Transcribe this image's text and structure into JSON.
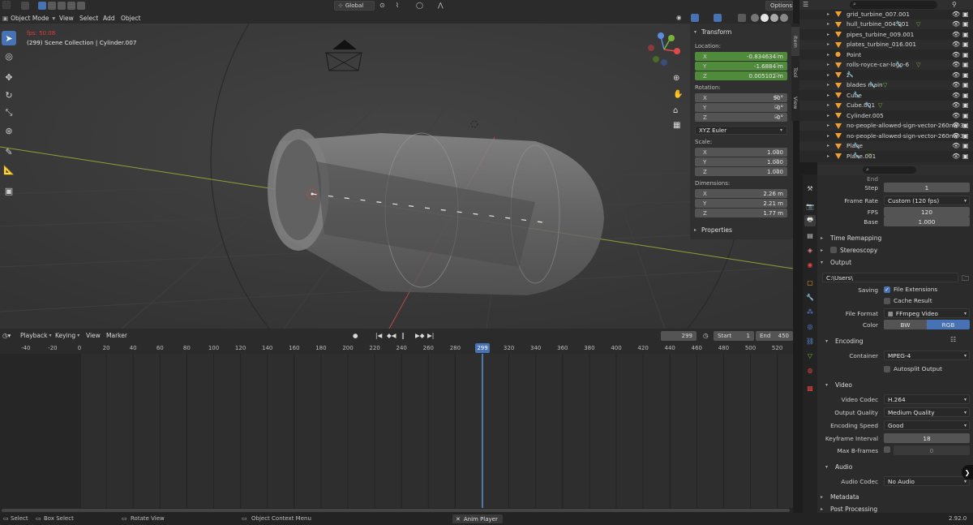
{
  "header": {
    "mode": "Object Mode",
    "menus": [
      "View",
      "Select",
      "Add",
      "Object"
    ],
    "orientation": "Global",
    "options_label": "Options"
  },
  "viewport": {
    "fps_text": "fps: 50.08",
    "collection_text": "(299) Scene Collection | Cylinder.007"
  },
  "npanel": {
    "tabs": [
      "Item",
      "Tool",
      "View"
    ],
    "transform_title": "Transform",
    "location_label": "Location:",
    "location": [
      {
        "axis": "X",
        "value": "-0.834634 m"
      },
      {
        "axis": "Y",
        "value": "-1.6884 m"
      },
      {
        "axis": "Z",
        "value": "0.005102 m"
      }
    ],
    "rotation_label": "Rotation:",
    "rotation": [
      {
        "axis": "X",
        "value": "90°"
      },
      {
        "axis": "Y",
        "value": "-0°"
      },
      {
        "axis": "Z",
        "value": "-0°"
      }
    ],
    "rotation_mode": "XYZ Euler",
    "scale_label": "Scale:",
    "scale": [
      {
        "axis": "X",
        "value": "1.000"
      },
      {
        "axis": "Y",
        "value": "1.000"
      },
      {
        "axis": "Z",
        "value": "1.000"
      }
    ],
    "dimensions_label": "Dimensions:",
    "dimensions": [
      {
        "axis": "X",
        "value": "2.26 m"
      },
      {
        "axis": "Y",
        "value": "2.21 m"
      },
      {
        "axis": "Z",
        "value": "1.77 m"
      }
    ],
    "properties_title": "Properties"
  },
  "timeline": {
    "menus": [
      "Playback",
      "Keying",
      "View",
      "Marker"
    ],
    "current_frame": "299",
    "start_label": "Start",
    "start": "1",
    "end_label": "End",
    "end": "450",
    "ruler": [
      "-40",
      "-20",
      "0",
      "20",
      "40",
      "60",
      "80",
      "100",
      "120",
      "140",
      "160",
      "180",
      "200",
      "220",
      "240",
      "260",
      "280",
      "299",
      "320",
      "340",
      "360",
      "380",
      "400",
      "420",
      "440",
      "460",
      "480",
      "500",
      "520"
    ]
  },
  "outliner": {
    "items": [
      {
        "name": "grid_turbine_007.001"
      },
      {
        "name": "hull_turbine_004.001"
      },
      {
        "name": "pipes_turbine_009.001"
      },
      {
        "name": "plates_turbine_016.001"
      },
      {
        "name": "Point"
      },
      {
        "name": "rolls-royce-car-logo-6"
      },
      {
        "name": "z"
      },
      {
        "name": "blades main"
      },
      {
        "name": "Cube"
      },
      {
        "name": "Cube.001"
      },
      {
        "name": "Cylinder.005"
      },
      {
        "name": "no-people-allowed-sign-vector-260nw-3"
      },
      {
        "name": "no-people-allowed-sign-vector-260nw-3"
      },
      {
        "name": "Plane"
      },
      {
        "name": "Plane.001"
      }
    ]
  },
  "properties": {
    "end_label": "End",
    "step_label": "Step",
    "step": "1",
    "frame_rate_label": "Frame Rate",
    "frame_rate": "Custom (120 fps)",
    "fps_label": "FPS",
    "fps": "120",
    "base_label": "Base",
    "base": "1.000",
    "time_remapping": "Time Remapping",
    "stereoscopy": "Stereoscopy",
    "output_section": "Output",
    "output_path": "C:\\Users\\",
    "saving_label": "Saving",
    "file_extensions": "File Extensions",
    "cache_result": "Cache Result",
    "file_format_label": "File Format",
    "file_format": "FFmpeg Video",
    "color_label": "Color",
    "color_bw": "BW",
    "color_rgb": "RGB",
    "encoding_section": "Encoding",
    "container_label": "Container",
    "container": "MPEG-4",
    "autosplit": "Autosplit Output",
    "video_section": "Video",
    "video_codec_label": "Video Codec",
    "video_codec": "H.264",
    "output_quality_label": "Output Quality",
    "output_quality": "Medium Quality",
    "encoding_speed_label": "Encoding Speed",
    "encoding_speed": "Good",
    "keyframe_label": "Keyframe Interval",
    "keyframe": "18",
    "max_b_label": "Max B-frames",
    "max_b": "0",
    "audio_section": "Audio",
    "audio_codec_label": "Audio Codec",
    "audio_codec": "No Audio",
    "metadata_section": "Metadata",
    "post_processing_section": "Post Processing"
  },
  "statusbar": {
    "select": "Select",
    "box_select": "Box Select",
    "rotate_view": "Rotate View",
    "context_menu": "Object Context Menu",
    "anim_player": "Anim Player",
    "version": "2.92.0"
  },
  "colors": {
    "accent": "#4772b3",
    "green_field": "#4f8b3a",
    "playhead": "#5c8fd6",
    "fps_red": "#e03c3c",
    "object_orange": "#f0a030"
  }
}
